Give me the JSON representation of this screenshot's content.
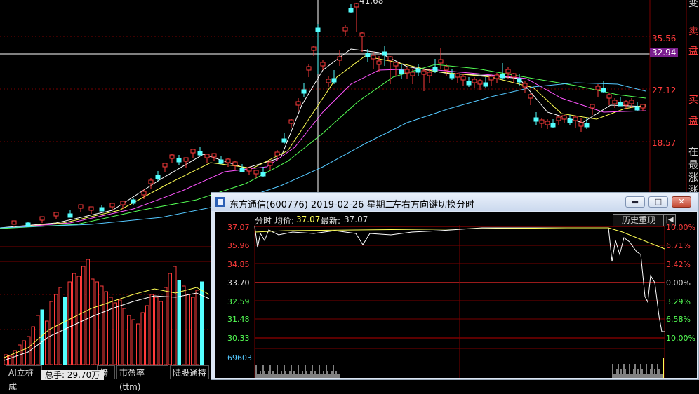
{
  "main_chart": {
    "price_axis": [
      "35.56",
      "27.12",
      "18.57"
    ],
    "current_price": "32.94",
    "peak_label": "41.68",
    "side_labels": [
      "卖",
      "盘",
      "买",
      "盘",
      "在",
      "最",
      "涨",
      "涨",
      "变"
    ],
    "colors": {
      "up": "#ff3b3b",
      "down": "#54ffff",
      "ma5": "#ffffff",
      "ma10": "#ffff54",
      "ma20": "#ff54ff",
      "ma30": "#54ff54",
      "ma60": "#54c8ff"
    }
  },
  "bottom_tabs": [
    "AI立桩成",
    "榜",
    "市盈率(ttm)",
    "陆股通持"
  ],
  "volume_tooltip": "总手: 29.70万",
  "popup": {
    "title": "东方通信(600776) 2019-02-26 星期二",
    "hint": "左右方向键切换分时",
    "window_buttons": [
      "▬",
      "□",
      "✕"
    ],
    "header_prefix": "分时",
    "header_avg_label": "均价:",
    "header_avg_value": "37.07",
    "header_last_label": "最新:",
    "header_last_value": "37.07",
    "history_button": "历史重现",
    "history_icon": "|◀",
    "price_levels": [
      "37.07",
      "35.96",
      "34.85",
      "33.70",
      "32.59",
      "31.48",
      "30.33"
    ],
    "pct_levels": [
      "10.00%",
      "6.71%",
      "3.42%",
      "0.00%",
      "3.29%",
      "6.58%",
      "10.00%"
    ],
    "volume_max": "69603"
  }
}
